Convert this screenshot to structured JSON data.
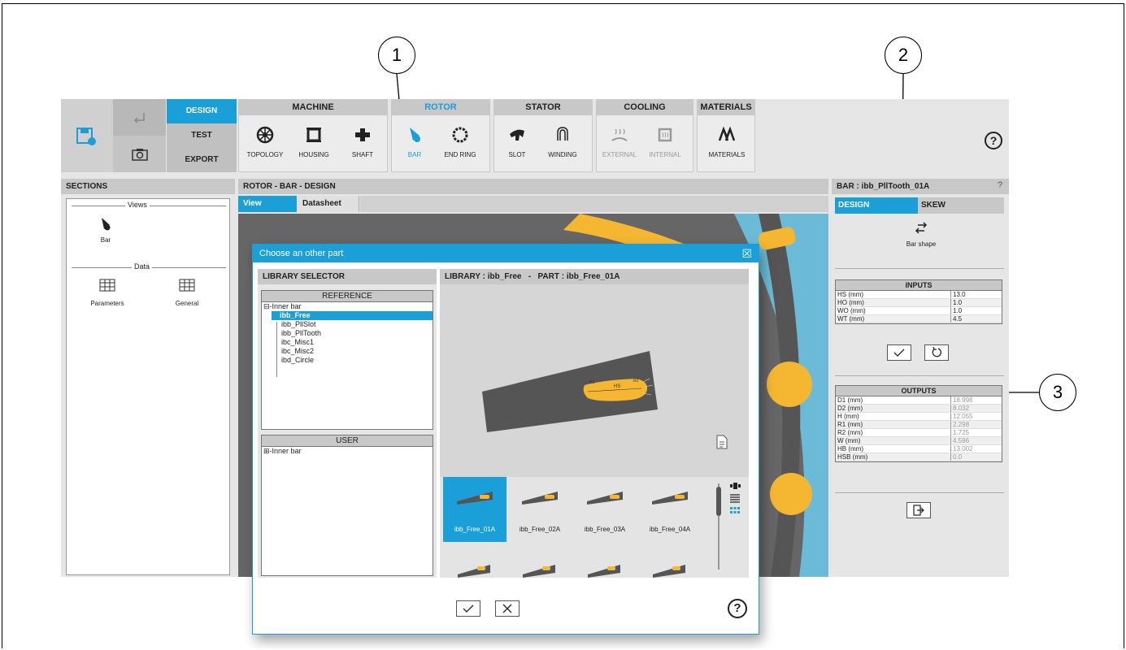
{
  "toolbar": {
    "design_label": "DESIGN",
    "test_label": "TEST",
    "export_label": "EXPORT",
    "groups": {
      "machine": {
        "title": "MACHINE",
        "tools": [
          "TOPOLOGY",
          "HOUSING",
          "SHAFT"
        ]
      },
      "rotor": {
        "title": "ROTOR",
        "tools": [
          "BAR",
          "END RING"
        ]
      },
      "stator": {
        "title": "STATOR",
        "tools": [
          "SLOT",
          "WINDING"
        ]
      },
      "cooling": {
        "title": "COOLING",
        "tools": [
          "EXTERNAL",
          "INTERNAL"
        ]
      },
      "materials": {
        "title": "MATERIALS",
        "tools": [
          "MATERIALS"
        ]
      }
    },
    "help_glyph": "?"
  },
  "sections": {
    "title": "SECTIONS",
    "views_label": "Views",
    "bar_label": "Bar",
    "data_label": "Data",
    "parameters_label": "Parameters",
    "general_label": "General"
  },
  "center": {
    "title": "ROTOR - BAR - DESIGN",
    "tab_view": "View",
    "tab_datasheet": "Datasheet"
  },
  "right": {
    "title": "BAR : ibb_PllTooth_01A",
    "help_glyph": "?",
    "tab_design": "DESIGN",
    "tab_skew": "SKEW",
    "bar_shape_label": "Bar shape",
    "inputs_title": "INPUTS",
    "inputs": [
      {
        "k": "HS (mm)",
        "v": "13.0"
      },
      {
        "k": "HO (mm)",
        "v": "1.0"
      },
      {
        "k": "WO (mm)",
        "v": "1.0"
      },
      {
        "k": "WT (mm)",
        "v": "4.5"
      }
    ],
    "outputs_title": "OUTPUTS",
    "outputs": [
      {
        "k": "D1 (mm)",
        "v": "18.998"
      },
      {
        "k": "D2 (mm)",
        "v": "8.032"
      },
      {
        "k": "H (mm)",
        "v": "12.055"
      },
      {
        "k": "R1 (mm)",
        "v": "2.298"
      },
      {
        "k": "R2 (mm)",
        "v": "1.725"
      },
      {
        "k": "W (mm)",
        "v": "4.596"
      },
      {
        "k": "HB (mm)",
        "v": "13.002"
      },
      {
        "k": "HSB (mm)",
        "v": "0.0"
      }
    ]
  },
  "dialog": {
    "title": "Choose an other part",
    "close_glyph": "☒",
    "library_selector_title": "LIBRARY SELECTOR",
    "reference_title": "REFERENCE",
    "reference_root": "⊟-Inner bar",
    "reference_items": [
      "ibb_Free",
      "ibb_PllSlot",
      "ibb_PllTooth",
      "ibc_Misc1",
      "ibc_Misc2",
      "ibd_Circle"
    ],
    "user_title": "USER",
    "user_root": "⊞-Inner bar",
    "preview_title": "LIBRARY : ibb_Free   -   PART : ibb_Free_01A",
    "preview_labels": {
      "hs": "HS",
      "r1": "R1",
      "r2": "R2"
    },
    "thumbs": [
      "ibb_Free_01A",
      "ibb_Free_02A",
      "ibb_Free_03A",
      "ibb_Free_04A"
    ],
    "help_glyph": "?"
  },
  "callouts": [
    "1",
    "2",
    "3"
  ],
  "colors": {
    "accent": "#1a9fd9",
    "bar_yellow": "#f5b731",
    "slot_dark": "#555555",
    "rotor_blue": "#6bbbd8"
  }
}
